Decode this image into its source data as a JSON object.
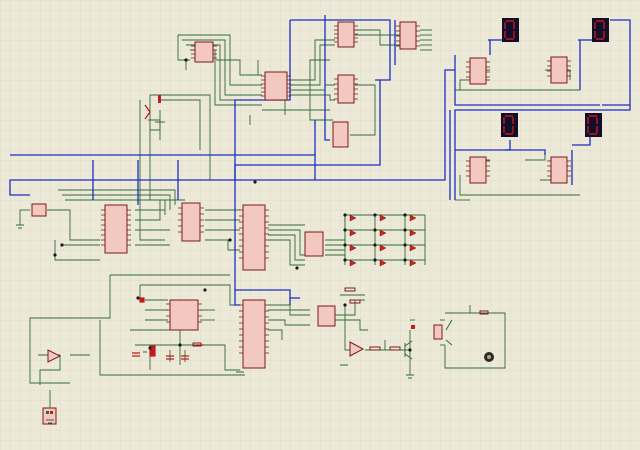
{
  "editor": {
    "name": "schematic-capture-canvas",
    "grid": "on",
    "colors": {
      "background": "#ece9d8",
      "grid_line": "#d5d1bd",
      "wire_green": "#2f6b37",
      "wire_blue": "#1d2fbf",
      "ic_body": "#f2c8c0",
      "ic_border": "#7a1a1a",
      "display_body": "#120d2b",
      "display_segment": "#c21b1b",
      "led_red": "#d21e1e",
      "junction": "#1a1a1a",
      "motor": "#2a2a2a"
    }
  },
  "components": {
    "seven_segment_displays": [
      {
        "name": "display-1"
      },
      {
        "name": "display-2"
      },
      {
        "name": "display-3"
      },
      {
        "name": "display-4"
      }
    ],
    "ics": [
      {
        "name": "ic-top-small"
      },
      {
        "name": "ic-top-left-counter"
      },
      {
        "name": "ic-top-center-a"
      },
      {
        "name": "ic-top-center-b"
      },
      {
        "name": "ic-top-right"
      },
      {
        "name": "ic-mid-small"
      },
      {
        "name": "ic-left-small"
      },
      {
        "name": "ic-left-large"
      },
      {
        "name": "ic-left-mid"
      },
      {
        "name": "ic-microcontroller-1"
      },
      {
        "name": "ic-decoder"
      },
      {
        "name": "ic-microcontroller-2"
      },
      {
        "name": "ic-bottom-left"
      },
      {
        "name": "ic-bottom-driver"
      },
      {
        "name": "ic-display-driver-1"
      },
      {
        "name": "ic-display-driver-2"
      },
      {
        "name": "ic-display-driver-3"
      },
      {
        "name": "ic-display-driver-4"
      }
    ],
    "led_matrix": {
      "rows": 4,
      "cols": 3
    },
    "motor": {
      "name": "dc-motor"
    },
    "opamp": {
      "name": "op-amp"
    },
    "sensor": {
      "name": "temperature-sensor"
    }
  }
}
